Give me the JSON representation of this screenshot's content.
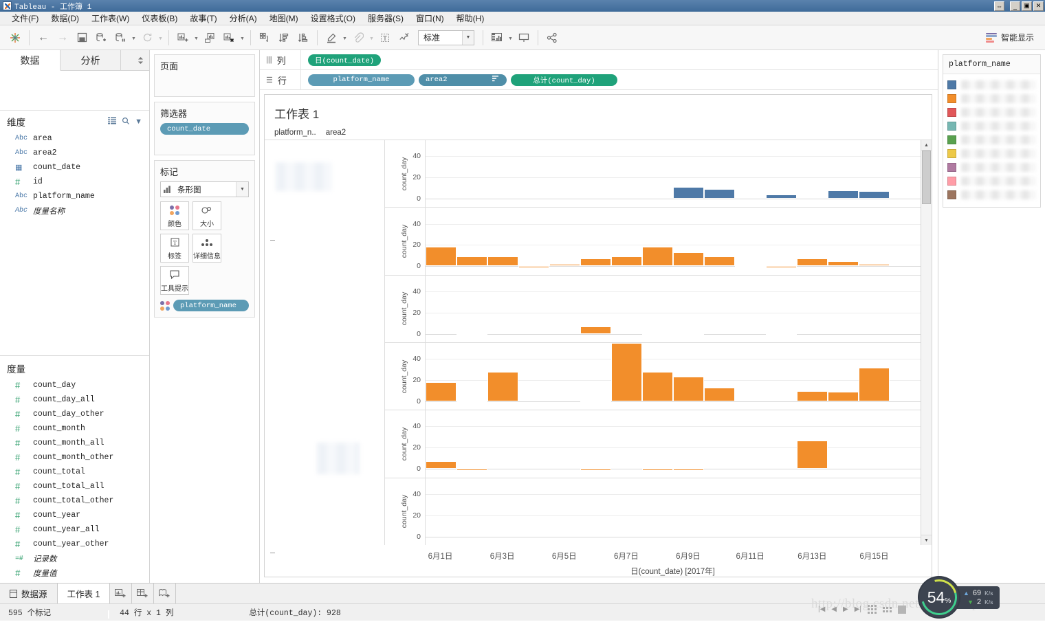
{
  "window": {
    "title": "Tableau - 工作簿 1",
    "buttons": {
      "restore_split": "⇔",
      "minimize": "_",
      "maximize": "▣",
      "close": "✕"
    }
  },
  "menu": [
    {
      "label": "文件(F)"
    },
    {
      "label": "数据(D)"
    },
    {
      "label": "工作表(W)"
    },
    {
      "label": "仪表板(B)"
    },
    {
      "label": "故事(T)"
    },
    {
      "label": "分析(A)"
    },
    {
      "label": "地图(M)"
    },
    {
      "label": "设置格式(O)"
    },
    {
      "label": "服务器(S)"
    },
    {
      "label": "窗口(N)"
    },
    {
      "label": "帮助(H)"
    }
  ],
  "toolbar": {
    "fit_value": "标准",
    "show_me_label": "智能显示",
    "icons": {
      "logo": "tableau-logo-icon",
      "back": "←",
      "forward": "→",
      "save": "save-icon",
      "new_source": "new-data-source-icon",
      "pause": "pause-icon",
      "refresh": "refresh-icon",
      "new_sheet": "new-worksheet-icon",
      "duplicate": "duplicate-sheet-icon",
      "clear": "clear-sheet-icon",
      "swap": "swap-rows-cols-icon",
      "sort_asc": "sort-asc-icon",
      "sort_desc": "sort-desc-icon",
      "highlight": "highlight-icon",
      "group": "group-icon",
      "labels": "show-labels-icon",
      "fix_axis": "fix-axes-icon",
      "presentation": "presentation-icon",
      "share": "share-icon"
    }
  },
  "left_pane": {
    "tabs": [
      {
        "label": "数据"
      },
      {
        "label": "分析"
      }
    ],
    "dimensions": {
      "title": "维度",
      "fields": [
        {
          "icon": "Abc",
          "type": "abc",
          "label": "area",
          "italic": false
        },
        {
          "icon": "Abc",
          "type": "abc",
          "label": "area2",
          "italic": false
        },
        {
          "icon": "📅",
          "type": "cal",
          "label": "count_date",
          "italic": false
        },
        {
          "icon": "#",
          "type": "num",
          "label": "id",
          "italic": false
        },
        {
          "icon": "Abc",
          "type": "abc",
          "label": "platform_name",
          "italic": false
        },
        {
          "icon": "Abc",
          "type": "abc",
          "label": "度量名称",
          "italic": true
        }
      ]
    },
    "measures": {
      "title": "度量",
      "fields": [
        {
          "icon": "#",
          "type": "num",
          "label": "count_day",
          "italic": false
        },
        {
          "icon": "#",
          "type": "num",
          "label": "count_day_all",
          "italic": false
        },
        {
          "icon": "#",
          "type": "num",
          "label": "count_day_other",
          "italic": false
        },
        {
          "icon": "#",
          "type": "num",
          "label": "count_month",
          "italic": false
        },
        {
          "icon": "#",
          "type": "num",
          "label": "count_month_all",
          "italic": false
        },
        {
          "icon": "#",
          "type": "num",
          "label": "count_month_other",
          "italic": false
        },
        {
          "icon": "#",
          "type": "num",
          "label": "count_total",
          "italic": false
        },
        {
          "icon": "#",
          "type": "num",
          "label": "count_total_all",
          "italic": false
        },
        {
          "icon": "#",
          "type": "num",
          "label": "count_total_other",
          "italic": false
        },
        {
          "icon": "#",
          "type": "num",
          "label": "count_year",
          "italic": false
        },
        {
          "icon": "#",
          "type": "num",
          "label": "count_year_all",
          "italic": false
        },
        {
          "icon": "#",
          "type": "num",
          "label": "count_year_other",
          "italic": false
        },
        {
          "icon": "=#",
          "type": "num",
          "label": "记录数",
          "italic": true
        },
        {
          "icon": "#",
          "type": "num",
          "label": "度量值",
          "italic": true
        }
      ]
    }
  },
  "cards": {
    "pages": {
      "title": "页面"
    },
    "filters": {
      "title": "筛选器",
      "pills": [
        {
          "label": "count_date",
          "color": "blue"
        }
      ]
    },
    "marks": {
      "title": "标记",
      "mark_type": "条形图",
      "buttons": [
        {
          "label": "颜色",
          "icon": "color-icon"
        },
        {
          "label": "大小",
          "icon": "size-icon"
        },
        {
          "label": "标签",
          "icon": "label-icon"
        },
        {
          "label": "详细信息",
          "icon": "detail-icon"
        },
        {
          "label": "工具提示",
          "icon": "tooltip-icon"
        }
      ],
      "pill": {
        "label": "platform_name",
        "color": "blue"
      }
    }
  },
  "shelves": {
    "columns": {
      "label": "列",
      "pills": [
        {
          "label": "日(count_date)",
          "color": "green"
        }
      ]
    },
    "rows": {
      "label": "行",
      "pills": [
        {
          "label": "platform_name",
          "color": "blue",
          "sorted": false
        },
        {
          "label": "area2",
          "color": "blue",
          "sorted": true
        },
        {
          "label": "总计(count_day)",
          "color": "green",
          "sorted": false
        }
      ]
    }
  },
  "worksheet": {
    "title": "工作表 1",
    "column_headers": [
      "platform_n..",
      "area2"
    ]
  },
  "legend": {
    "title": "platform_name",
    "swatches": [
      "#4e79a7",
      "#f28e2b",
      "#e15759",
      "#76b7b2",
      "#59a14f",
      "#edc948",
      "#b07aa1",
      "#ff9da7",
      "#9c755f"
    ]
  },
  "chart_data": {
    "type": "bar",
    "title": "工作表 1",
    "xlabel": "日(count_date) [2017年]",
    "ylabel": "count_day",
    "ylim": [
      -8,
      55
    ],
    "grid": true,
    "legend_position": "right",
    "x": [
      "6月1日",
      "6月2日",
      "6月3日",
      "6月4日",
      "6月5日",
      "6月6日",
      "6月7日",
      "6月8日",
      "6月9日",
      "6月10日",
      "6月11日",
      "6月12日",
      "6月13日",
      "6月14日",
      "6月15日",
      "6月16日"
    ],
    "xtick_labels": [
      "6月1日",
      "6月3日",
      "6月5日",
      "6月7日",
      "6月9日",
      "6月11日",
      "6月13日",
      "6月15日"
    ],
    "ytick_labels": [
      "0",
      "20",
      "40"
    ],
    "panels": [
      {
        "index": 1,
        "color": "#4e79a7",
        "values": [
          null,
          null,
          null,
          null,
          null,
          null,
          null,
          null,
          11,
          9,
          null,
          4,
          1.5,
          8,
          7,
          null
        ]
      },
      {
        "index": 2,
        "color": "#f28e2b",
        "values": [
          18,
          9,
          9,
          -1.5,
          2,
          7,
          9,
          18,
          13,
          9,
          -1,
          -1.5,
          7,
          5,
          2,
          null
        ]
      },
      {
        "index": 3,
        "color": "#f28e2b",
        "values": [
          null,
          -1,
          null,
          null,
          null,
          7,
          null,
          -1,
          -1.5,
          null,
          null,
          -1,
          null,
          null,
          null,
          null
        ]
      },
      {
        "index": 4,
        "color": "#f28e2b",
        "values": [
          18,
          -1.5,
          28,
          null,
          null,
          -1.5,
          55,
          28,
          23,
          13,
          null,
          null,
          10,
          9,
          32,
          null
        ]
      },
      {
        "index": 5,
        "color": "#f28e2b",
        "values": [
          7,
          -1.5,
          null,
          null,
          null,
          -1.5,
          null,
          -1.5,
          -1.5,
          null,
          null,
          null,
          27,
          null,
          null,
          null
        ]
      },
      {
        "index": 6,
        "color": "#f28e2b",
        "values": [
          null,
          null,
          null,
          null,
          null,
          null,
          null,
          null,
          null,
          null,
          null,
          null,
          null,
          null,
          null,
          null
        ]
      }
    ]
  },
  "sheet_bar": {
    "data_source_label": "数据源",
    "sheets": [
      {
        "label": "工作表 1",
        "active": true
      }
    ],
    "new_buttons": [
      "new-worksheet-icon",
      "new-dashboard-icon",
      "new-story-icon"
    ]
  },
  "status_bar": {
    "marks": "595 个标记",
    "size": "44 行 x 1 列",
    "total": "总计(count_day): 928"
  },
  "overlay": {
    "watermark": "http://blog.csdn.net/vhasbdelphi",
    "perf": {
      "percent": "54",
      "percent_sym": "%",
      "up": "69",
      "up_unit": "K/s",
      "down": "2",
      "down_unit": "K/s"
    }
  }
}
